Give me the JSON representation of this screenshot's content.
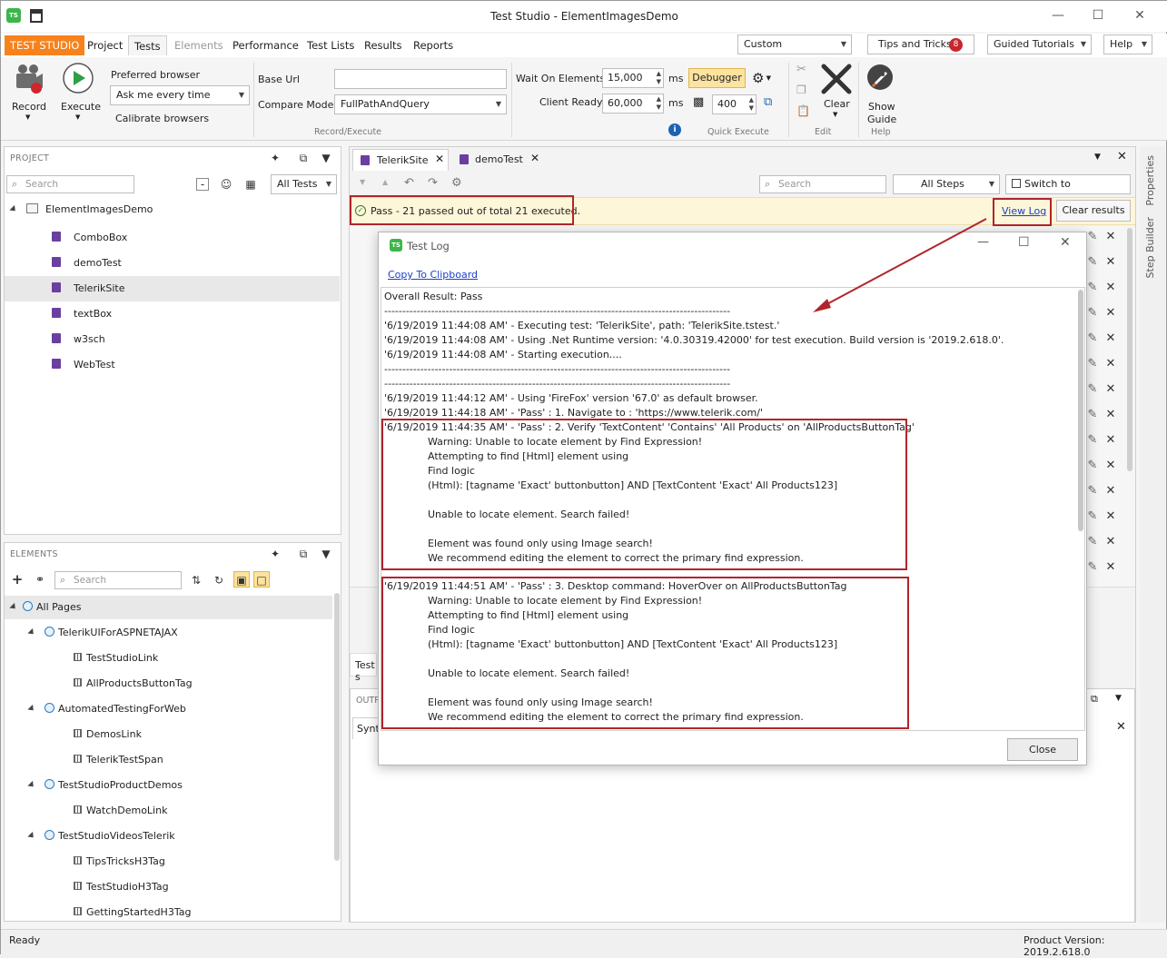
{
  "window": {
    "title": "Test Studio - ElementImagesDemo",
    "app_icon": "TS"
  },
  "menu": {
    "brand": "TEST STUDIO",
    "items": [
      "Project",
      "Tests",
      "Elements",
      "Performance",
      "Test Lists",
      "Results",
      "Reports"
    ],
    "layout_select": "Custom",
    "tips_label": "Tips and Tricks",
    "tips_count": "8",
    "guided_tutorials": "Guided Tutorials",
    "help": "Help"
  },
  "ribbon": {
    "record": "Record",
    "execute": "Execute",
    "preferred_browser_label": "Preferred browser",
    "preferred_browser_value": "Ask me every time",
    "calibrate": "Calibrate browsers",
    "base_url_label": "Base Url",
    "base_url_value": "",
    "compare_mode_label": "Compare Mode",
    "compare_mode_value": "FullPathAndQuery",
    "group_record_execute": "Record/Execute",
    "wait_label": "Wait On Elements",
    "wait_value": "15,000",
    "wait_unit": "ms",
    "client_ready_label": "Client Ready",
    "client_ready_value": "60,000",
    "client_ready_unit": "ms",
    "debugger": "Debugger",
    "speed_value": "400",
    "group_quick_execute": "Quick Execute",
    "clear": "Clear",
    "group_edit": "Edit",
    "show_guide_1": "Show",
    "show_guide_2": "Guide",
    "group_help": "Help"
  },
  "project_panel": {
    "header": "PROJECT",
    "search_placeholder": "Search",
    "filter": "All Tests",
    "root": "ElementImagesDemo",
    "tests": [
      "ComboBox",
      "demoTest",
      "TelerikSite",
      "textBox",
      "w3sch",
      "WebTest"
    ],
    "selected_index": 2
  },
  "elements_panel": {
    "header": "ELEMENTS",
    "search_placeholder": "Search",
    "root": "All Pages",
    "pages": [
      {
        "name": "TelerikUIForASPNETAJAX",
        "elements": [
          "TestStudioLink",
          "AllProductsButtonTag"
        ]
      },
      {
        "name": "AutomatedTestingForWeb",
        "elements": [
          "DemosLink",
          "TelerikTestSpan"
        ]
      },
      {
        "name": "TestStudioProductDemos",
        "elements": [
          "WatchDemoLink"
        ]
      },
      {
        "name": "TestStudioVideosTelerik",
        "elements": [
          "TipsTricksH3Tag",
          "TestStudioH3Tag",
          "GettingStartedH3Tag"
        ]
      }
    ]
  },
  "editor": {
    "tabs": [
      "TelerikSite",
      "demoTest"
    ],
    "search_placeholder": "Search",
    "steps_filter": "All Steps",
    "storyboard": "Switch to Storyboard",
    "result_text": "Pass - 21 passed out of total 21 executed.",
    "view_log": "View Log",
    "clear_results": "Clear results",
    "test_status_partial": "Test s",
    "output_partial": "OUTP",
    "syntax_partial": "Synt"
  },
  "side_tabs": [
    "Properties",
    "Step Builder"
  ],
  "test_log": {
    "title": "Test Log",
    "copy": "Copy To Clipboard",
    "lines": [
      "Overall Result: Pass",
      "------------------------------------------------------------------------------------------------",
      "'6/19/2019 11:44:08 AM' - Executing test: 'TelerikSite', path: 'TelerikSite.tstest.'",
      "'6/19/2019 11:44:08 AM' - Using .Net Runtime version: '4.0.30319.42000' for test execution. Build version is '2019.2.618.0'.",
      "'6/19/2019 11:44:08 AM' - Starting execution....",
      "------------------------------------------------------------------------------------------------",
      "------------------------------------------------------------------------------------------------",
      "'6/19/2019 11:44:12 AM' - Using 'FireFox' version '67.0' as default browser.",
      "'6/19/2019 11:44:18 AM' - 'Pass' : 1. Navigate to : 'https://www.telerik.com/'"
    ],
    "block1": {
      "head": "'6/19/2019 11:44:35 AM' - 'Pass' : 2. Verify 'TextContent' 'Contains' 'All Products' on 'AllProductsButtonTag'",
      "lines": [
        "Warning: Unable to locate element by Find Expression!",
        "Attempting to find [Html] element using",
        "Find logic",
        " (Html): [tagname 'Exact' buttonbutton] AND [TextContent 'Exact' All Products123]",
        "",
        "Unable to locate element. Search failed!",
        "",
        "Element was found only using Image search!",
        "We recommend editing the element to correct the primary find expression."
      ]
    },
    "block2": {
      "head": "'6/19/2019 11:44:51 AM' - 'Pass' : 3. Desktop command: HoverOver on AllProductsButtonTag",
      "lines": [
        "Warning: Unable to locate element by Find Expression!",
        "Attempting to find [Html] element using",
        "Find logic",
        " (Html): [tagname 'Exact' buttonbutton] AND [TextContent 'Exact' All Products123]",
        "",
        "Unable to locate element. Search failed!",
        "",
        "Element was found only using Image search!",
        "We recommend editing the element to correct the primary find expression."
      ]
    },
    "close": "Close"
  },
  "status": {
    "left": "Ready",
    "right": "Product Version: 2019.2.618.0"
  },
  "colors": {
    "brand": "#f7821b",
    "highlight": "#b1252a",
    "pass_banner": "#fdf6d9"
  }
}
